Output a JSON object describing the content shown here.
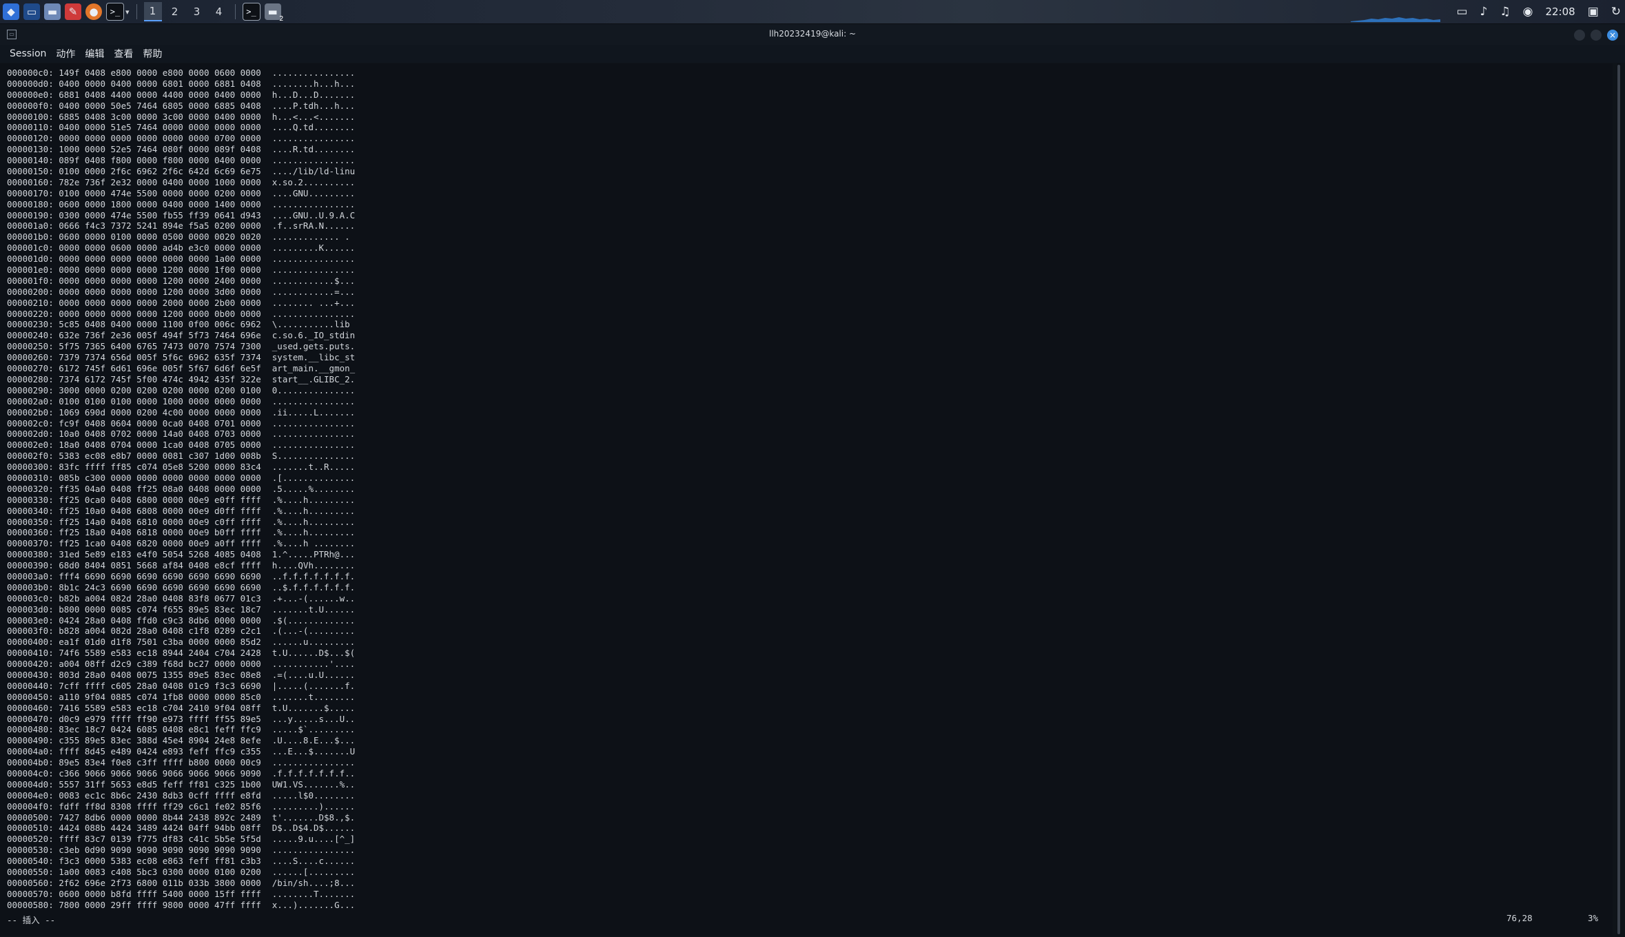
{
  "taskbar": {
    "workspaces": [
      "1",
      "2",
      "3",
      "4"
    ],
    "active_workspace": "1",
    "clock": "22:08",
    "badge": "2",
    "icons": [
      "kali-menu-icon",
      "terminal-icon",
      "folder-icon",
      "text-editor-icon",
      "firefox-icon",
      "terminal-icon"
    ]
  },
  "window": {
    "title": "llh20232419@kali: ~"
  },
  "menu": [
    "Session",
    "动作",
    "编辑",
    "查看",
    "帮助"
  ],
  "terminal": {
    "lines": [
      {
        "hex": "000000c0: 149f 0408 e800 0000 e800 0000 0600 0000",
        "ascii": "................"
      },
      {
        "hex": "000000d0: 0400 0000 0400 0000 6801 0000 6881 0408",
        "ascii": "........h...h..."
      },
      {
        "hex": "000000e0: 6881 0408 4400 0000 4400 0000 0400 0000",
        "ascii": "h...D...D......."
      },
      {
        "hex": "000000f0: 0400 0000 50e5 7464 6805 0000 6885 0408",
        "ascii": "....P.tdh...h..."
      },
      {
        "hex": "00000100: 6885 0408 3c00 0000 3c00 0000 0400 0000",
        "ascii": "h...<...<......."
      },
      {
        "hex": "00000110: 0400 0000 51e5 7464 0000 0000 0000 0000",
        "ascii": "....Q.td........"
      },
      {
        "hex": "00000120: 0000 0000 0000 0000 0000 0000 0700 0000",
        "ascii": "................"
      },
      {
        "hex": "00000130: 1000 0000 52e5 7464 080f 0000 089f 0408",
        "ascii": "....R.td........"
      },
      {
        "hex": "00000140: 089f 0408 f800 0000 f800 0000 0400 0000",
        "ascii": "................"
      },
      {
        "hex": "00000150: 0100 0000 2f6c 6962 2f6c 642d 6c69 6e75",
        "ascii": "..../lib/ld-linu"
      },
      {
        "hex": "00000160: 782e 736f 2e32 0000 0400 0000 1000 0000",
        "ascii": "x.so.2.........."
      },
      {
        "hex": "00000170: 0100 0000 474e 5500 0000 0000 0200 0000",
        "ascii": "....GNU........."
      },
      {
        "hex": "00000180: 0600 0000 1800 0000 0400 0000 1400 0000",
        "ascii": "................"
      },
      {
        "hex": "00000190: 0300 0000 474e 5500 fb55 ff39 0641 d943",
        "ascii": "....GNU..U.9.A.C"
      },
      {
        "hex": "000001a0: 0666 f4c3 7372 5241 894e f5a5 0200 0000",
        "ascii": ".f..srRA.N......"
      },
      {
        "hex": "000001b0: 0600 0000 0100 0000 0500 0000 0020 0020",
        "ascii": "............. ."
      },
      {
        "hex": "000001c0: 0000 0000 0600 0000 ad4b e3c0 0000 0000",
        "ascii": ".........K......"
      },
      {
        "hex": "000001d0: 0000 0000 0000 0000 0000 0000 1a00 0000",
        "ascii": "................"
      },
      {
        "hex": "000001e0: 0000 0000 0000 0000 1200 0000 1f00 0000",
        "ascii": "................"
      },
      {
        "hex": "000001f0: 0000 0000 0000 0000 1200 0000 2400 0000",
        "ascii": "............$..."
      },
      {
        "hex": "00000200: 0000 0000 0000 0000 1200 0000 3d00 0000",
        "ascii": "............=..."
      },
      {
        "hex": "00000210: 0000 0000 0000 0000 2000 0000 2b00 0000",
        "ascii": "........ ...+..."
      },
      {
        "hex": "00000220: 0000 0000 0000 0000 1200 0000 0b00 0000",
        "ascii": "................"
      },
      {
        "hex": "00000230: 5c85 0408 0400 0000 1100 0f00 006c 6962",
        "ascii": "\\...........lib"
      },
      {
        "hex": "00000240: 632e 736f 2e36 005f 494f 5f73 7464 696e",
        "ascii": "c.so.6._IO_stdin"
      },
      {
        "hex": "00000250: 5f75 7365 6400 6765 7473 0070 7574 7300",
        "ascii": "_used.gets.puts."
      },
      {
        "hex": "00000260: 7379 7374 656d 005f 5f6c 6962 635f 7374",
        "ascii": "system.__libc_st"
      },
      {
        "hex": "00000270: 6172 745f 6d61 696e 005f 5f67 6d6f 6e5f",
        "ascii": "art_main.__gmon_"
      },
      {
        "hex": "00000280: 7374 6172 745f 5f00 474c 4942 435f 322e",
        "ascii": "start__.GLIBC_2."
      },
      {
        "hex": "00000290: 3000 0000 0200 0200 0200 0000 0200 0100",
        "ascii": "0..............."
      },
      {
        "hex": "000002a0: 0100 0100 0100 0000 1000 0000 0000 0000",
        "ascii": "................"
      },
      {
        "hex": "000002b0: 1069 690d 0000 0200 4c00 0000 0000 0000",
        "ascii": ".ii.....L......."
      },
      {
        "hex": "000002c0: fc9f 0408 0604 0000 0ca0 0408 0701 0000",
        "ascii": "................"
      },
      {
        "hex": "000002d0: 10a0 0408 0702 0000 14a0 0408 0703 0000",
        "ascii": "................"
      },
      {
        "hex": "000002e0: 18a0 0408 0704 0000 1ca0 0408 0705 0000",
        "ascii": "................"
      },
      {
        "hex": "000002f0: 5383 ec08 e8b7 0000 0081 c307 1d00 008b",
        "ascii": "S..............."
      },
      {
        "hex": "00000300: 83fc ffff ff85 c074 05e8 5200 0000 83c4",
        "ascii": ".......t..R....."
      },
      {
        "hex": "00000310: 085b c300 0000 0000 0000 0000 0000 0000",
        "ascii": ".[.............."
      },
      {
        "hex": "00000320: ff35 04a0 0408 ff25 08a0 0408 0000 0000",
        "ascii": ".5.....%........"
      },
      {
        "hex": "00000330: ff25 0ca0 0408 6800 0000 00e9 e0ff ffff",
        "ascii": ".%....h........."
      },
      {
        "hex": "00000340: ff25 10a0 0408 6808 0000 00e9 d0ff ffff",
        "ascii": ".%....h........."
      },
      {
        "hex": "00000350: ff25 14a0 0408 6810 0000 00e9 c0ff ffff",
        "ascii": ".%....h........."
      },
      {
        "hex": "00000360: ff25 18a0 0408 6818 0000 00e9 b0ff ffff",
        "ascii": ".%....h........."
      },
      {
        "hex": "00000370: ff25 1ca0 0408 6820 0000 00e9 a0ff ffff",
        "ascii": ".%....h ........"
      },
      {
        "hex": "00000380: 31ed 5e89 e183 e4f0 5054 5268 4085 0408",
        "ascii": "1.^.....PTRh@..."
      },
      {
        "hex": "00000390: 68d0 8404 0851 5668 af84 0408 e8cf ffff",
        "ascii": "h....QVh........"
      },
      {
        "hex": "000003a0: fff4 6690 6690 6690 6690 6690 6690 6690",
        "ascii": "..f.f.f.f.f.f.f."
      },
      {
        "hex": "000003b0: 8b1c 24c3 6690 6690 6690 6690 6690 6690",
        "ascii": "..$.f.f.f.f.f.f."
      },
      {
        "hex": "000003c0: b82b a004 082d 28a0 0408 83f8 0677 01c3",
        "ascii": ".+...-(......w.."
      },
      {
        "hex": "000003d0: b800 0000 0085 c074 f655 89e5 83ec 18c7",
        "ascii": ".......t.U......"
      },
      {
        "hex": "000003e0: 0424 28a0 0408 ffd0 c9c3 8db6 0000 0000",
        "ascii": ".$(............."
      },
      {
        "hex": "000003f0: b828 a004 082d 28a0 0408 c1f8 0289 c2c1",
        "ascii": ".(...-(........."
      },
      {
        "hex": "00000400: ea1f 01d0 d1f8 7501 c3ba 0000 0000 85d2",
        "ascii": "......u........."
      },
      {
        "hex": "00000410: 74f6 5589 e583 ec18 8944 2404 c704 2428",
        "ascii": "t.U......D$...$("
      },
      {
        "hex": "00000420: a004 08ff d2c9 c389 f68d bc27 0000 0000",
        "ascii": "...........'...."
      },
      {
        "hex": "00000430: 803d 28a0 0408 0075 1355 89e5 83ec 08e8",
        "ascii": ".=(....u.U......"
      },
      {
        "hex": "00000440: 7cff ffff c605 28a0 0408 01c9 f3c3 6690",
        "ascii": "|.....(.......f."
      },
      {
        "hex": "00000450: a110 9f04 0885 c074 1fb8 0000 0000 85c0",
        "ascii": ".......t........"
      },
      {
        "hex": "00000460: 7416 5589 e583 ec18 c704 2410 9f04 08ff",
        "ascii": "t.U.......$....."
      },
      {
        "hex": "00000470: d0c9 e979 ffff ff90 e973 ffff ff55 89e5",
        "ascii": "...y.....s...U.."
      },
      {
        "hex": "00000480: 83ec 18c7 0424 6085 0408 e8c1 feff ffc9",
        "ascii": ".....$`........."
      },
      {
        "hex": "00000490: c355 89e5 83ec 388d 45e4 8904 24e8 8efe",
        "ascii": ".U....8.E...$..."
      },
      {
        "hex": "000004a0: ffff 8d45 e489 0424 e893 feff ffc9 c355",
        "ascii": "...E...$.......U"
      },
      {
        "hex": "000004b0: 89e5 83e4 f0e8 c3ff ffff b800 0000 00c9",
        "ascii": "................"
      },
      {
        "hex": "000004c0: c366 9066 9066 9066 9066 9066 9066 9090",
        "ascii": ".f.f.f.f.f.f.f.."
      },
      {
        "hex": "000004d0: 5557 31ff 5653 e8d5 feff ff81 c325 1b00",
        "ascii": "UW1.VS.......%.."
      },
      {
        "hex": "000004e0: 0083 ec1c 8b6c 2430 8db3 0cff ffff e8fd",
        "ascii": ".....l$0........"
      },
      {
        "hex": "000004f0: fdff ff8d 8308 ffff ff29 c6c1 fe02 85f6",
        "ascii": ".........)......"
      },
      {
        "hex": "00000500: 7427 8db6 0000 0000 8b44 2438 892c 2489",
        "ascii": "t'.......D$8.,$."
      },
      {
        "hex": "00000510: 4424 088b 4424 3489 4424 04ff 94bb 08ff",
        "ascii": "D$..D$4.D$......"
      },
      {
        "hex": "00000520: ffff 83c7 0139 f775 df83 c41c 5b5e 5f5d",
        "ascii": ".....9.u....[^_]"
      },
      {
        "hex": "00000530: c3eb 0d90 9090 9090 9090 9090 9090 9090",
        "ascii": "................"
      },
      {
        "hex": "00000540: f3c3 0000 5383 ec08 e863 feff ff81 c3b3",
        "ascii": "....S....c......"
      },
      {
        "hex": "00000550: 1a00 0083 c408 5bc3 0300 0000 0100 0200",
        "ascii": "......[........."
      },
      {
        "hex": "00000560: 2f62 696e 2f73 6800 011b 033b 3800 0000",
        "ascii": "/bin/sh....;8..."
      },
      {
        "hex": "00000570: 0600 0000 b8fd ffff 5400 0000 15ff ffff",
        "ascii": "........T......."
      },
      {
        "hex": "00000580: 7800 0000 29ff ffff 9800 0000 47ff ffff",
        "ascii": "x...).......G..."
      }
    ],
    "mode": "-- 插入 --",
    "position": "76,28",
    "percent": "3%"
  }
}
